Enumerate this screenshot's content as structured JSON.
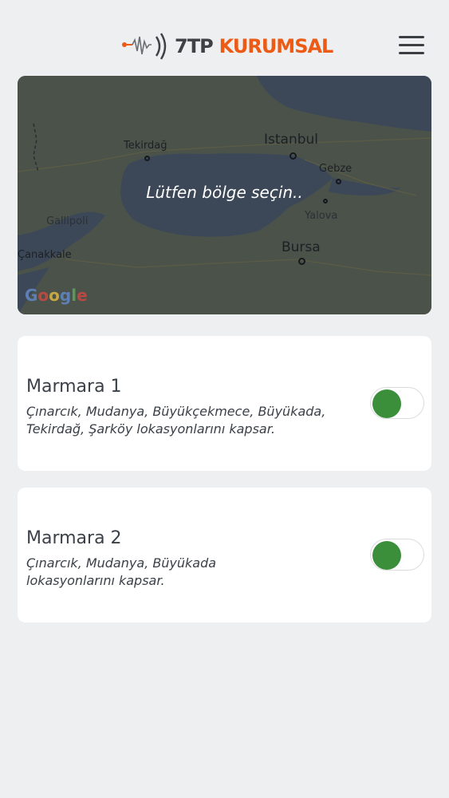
{
  "header": {
    "logo_number": "7TP",
    "logo_brand": "KURUMSAL",
    "logo_icon": "waveform-icon",
    "menu_icon": "hamburger-menu-icon"
  },
  "map": {
    "prompt": "Lütfen bölge seçin..",
    "provider_logo": "Google",
    "cities": {
      "istanbul": "Istanbul",
      "tekirdag": "Tekirdağ",
      "gebze": "Gebze",
      "gallipoli": "Gallipoli",
      "yalova": "Yalova",
      "canakkale": "Çanakkale",
      "bursa": "Bursa"
    }
  },
  "regions": [
    {
      "title": "Marmara 1",
      "description": "Çınarcık, Mudanya, Büyükçekmece, Büyükada, Tekirdağ, Şarköy lokasyonlarını kapsar.",
      "enabled": true
    },
    {
      "title": "Marmara 2",
      "description": "Çınarcık, Mudanya, Büyükada lokasyonlarını kapsar.",
      "enabled": true
    }
  ],
  "colors": {
    "brand_orange": "#ec5a14",
    "toggle_on": "#3b8f3b",
    "background": "#eeeff1"
  }
}
